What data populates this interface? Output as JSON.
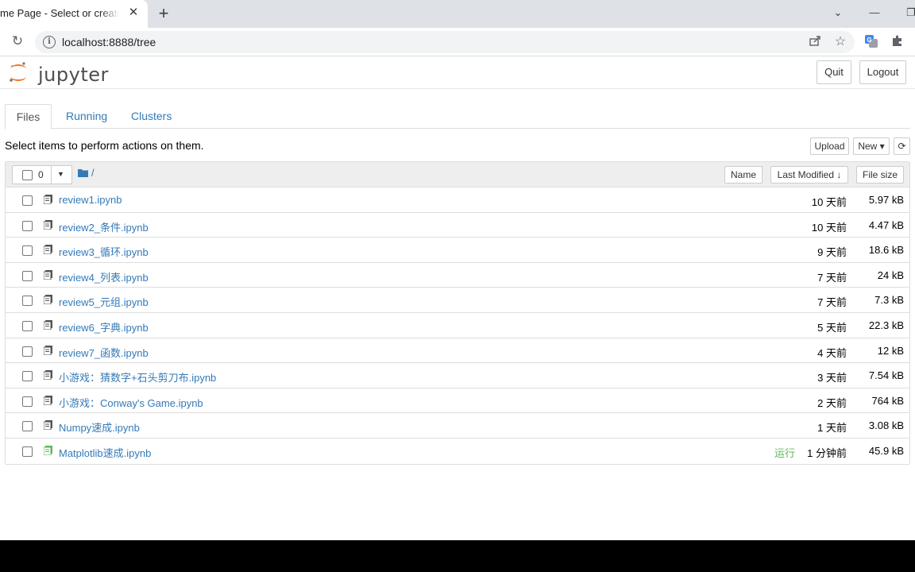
{
  "browser": {
    "tab_title": "me Page - Select or create a notebook",
    "tab_close": "✕",
    "new_tab": "+",
    "url": "localhost:8888/tree",
    "window_controls": [
      "⌄",
      "—",
      "❐"
    ]
  },
  "app": {
    "logo_text": "jupyter",
    "quit_label": "Quit",
    "logout_label": "Logout"
  },
  "tabs": [
    "Files",
    "Running",
    "Clusters"
  ],
  "active_tab": "Files",
  "hint": "Select items to perform actions on them.",
  "actions": {
    "upload": "Upload",
    "new": "New ▾",
    "refresh_icon": "refresh-icon"
  },
  "list_header": {
    "selected_count": "0",
    "breadcrumb": "/",
    "name_col": "Name",
    "modified_col": "Last Modified ↓",
    "size_col": "File size"
  },
  "files": [
    {
      "name": "review1.ipynb",
      "modified": "10 天前",
      "size": "5.97 kB",
      "running": ""
    },
    {
      "name": "review2_条件.ipynb",
      "modified": "10 天前",
      "size": "4.47 kB",
      "running": ""
    },
    {
      "name": "review3_循环.ipynb",
      "modified": "9 天前",
      "size": "18.6 kB",
      "running": ""
    },
    {
      "name": "review4_列表.ipynb",
      "modified": "7 天前",
      "size": "24 kB",
      "running": ""
    },
    {
      "name": "review5_元组.ipynb",
      "modified": "7 天前",
      "size": "7.3 kB",
      "running": ""
    },
    {
      "name": "review6_字典.ipynb",
      "modified": "5 天前",
      "size": "22.3 kB",
      "running": ""
    },
    {
      "name": "review7_函数.ipynb",
      "modified": "4 天前",
      "size": "12 kB",
      "running": ""
    },
    {
      "name": "小游戏：猜数字+石头剪刀布.ipynb",
      "modified": "3 天前",
      "size": "7.54 kB",
      "running": ""
    },
    {
      "name": "小游戏：Conway's Game.ipynb",
      "modified": "2 天前",
      "size": "764 kB",
      "running": ""
    },
    {
      "name": "Numpy速成.ipynb",
      "modified": "1 天前",
      "size": "3.08 kB",
      "running": ""
    },
    {
      "name": "Matplotlib速成.ipynb",
      "modified": "1 分钟前",
      "size": "45.9 kB",
      "running": "运行"
    }
  ],
  "colors": {
    "link": "#337ab7",
    "running": "#5cb85c",
    "logo_orange": "#f37726"
  }
}
